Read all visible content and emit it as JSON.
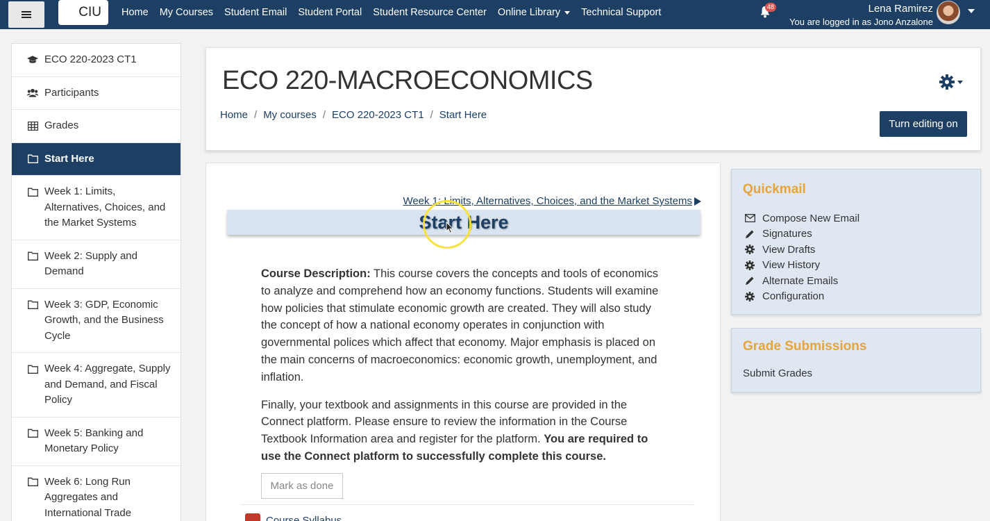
{
  "navbar": {
    "logo": "CIU",
    "links": [
      "Home",
      "My Courses",
      "Student Email",
      "Student Portal",
      "Student Resource Center",
      "Online Library",
      "Technical Support"
    ],
    "notification_count": "48",
    "user_name": "Lena Ramirez",
    "logged_in_as": "You are logged in as Jono Anzalone"
  },
  "sidebar": {
    "items": [
      {
        "label": "ECO 220-2023 CT1",
        "icon": "graduation-cap-icon"
      },
      {
        "label": "Participants",
        "icon": "users-icon"
      },
      {
        "label": "Grades",
        "icon": "table-icon"
      },
      {
        "label": "Start Here",
        "icon": "folder-icon"
      },
      {
        "label": "Week 1: Limits, Alternatives, Choices, and the Market Systems",
        "icon": "folder-icon"
      },
      {
        "label": "Week 2: Supply and Demand",
        "icon": "folder-icon"
      },
      {
        "label": "Week 3: GDP, Economic Growth, and the Business Cycle",
        "icon": "folder-icon"
      },
      {
        "label": "Week 4: Aggregate, Supply and Demand, and Fiscal Policy",
        "icon": "folder-icon"
      },
      {
        "label": "Week 5: Banking and Monetary Policy",
        "icon": "folder-icon"
      },
      {
        "label": "Week 6: Long Run Aggregates and International Trade",
        "icon": "folder-icon"
      }
    ]
  },
  "header": {
    "course_title": "ECO 220-MACROECONOMICS",
    "breadcrumb": [
      "Home",
      "My courses",
      "ECO 220-2023 CT1",
      "Start Here"
    ],
    "breadcrumb_separator": "/",
    "edit_button": "Turn editing on"
  },
  "main": {
    "next_section_link": "Week 1: Limits, Alternatives, Choices, and the Market Systems",
    "section_title": "Start Here",
    "description_label": "Course Description:",
    "description_text": " This course covers the concepts and tools of economics to analyze and comprehend how an economy functions. Students will examine how policies that stimulate economic growth are created. They will also study the concept of how a national economy operates in conjunction with governmental polices which affect that economy. Major emphasis is placed on the main concerns of macroeconomics: economic growth, unemployment, and inflation.",
    "paragraph2_text": "Finally, your textbook and assignments in this course are provided in the Connect platform. Please ensure to review the information in the Course Textbook Information area and register for the platform. ",
    "paragraph2_bold": "You are required to use the Connect platform to successfully complete this course.",
    "mark_done_button": "Mark as done",
    "next_activity_label": "Course Syllabus"
  },
  "quickmail": {
    "title": "Quickmail",
    "items": [
      {
        "label": "Compose New Email",
        "icon": "envelope-icon"
      },
      {
        "label": "Signatures",
        "icon": "pencil-icon"
      },
      {
        "label": "View Drafts",
        "icon": "gear-icon"
      },
      {
        "label": "View History",
        "icon": "gear-icon"
      },
      {
        "label": "Alternate Emails",
        "icon": "pencil-icon"
      },
      {
        "label": "Configuration",
        "icon": "gear-icon"
      }
    ]
  },
  "grade_submissions": {
    "title": "Grade Submissions",
    "link": "Submit Grades"
  },
  "colors": {
    "navy": "#1c3f63",
    "accent_orange": "#e6a43a",
    "block_bg": "#dfe7f2"
  }
}
